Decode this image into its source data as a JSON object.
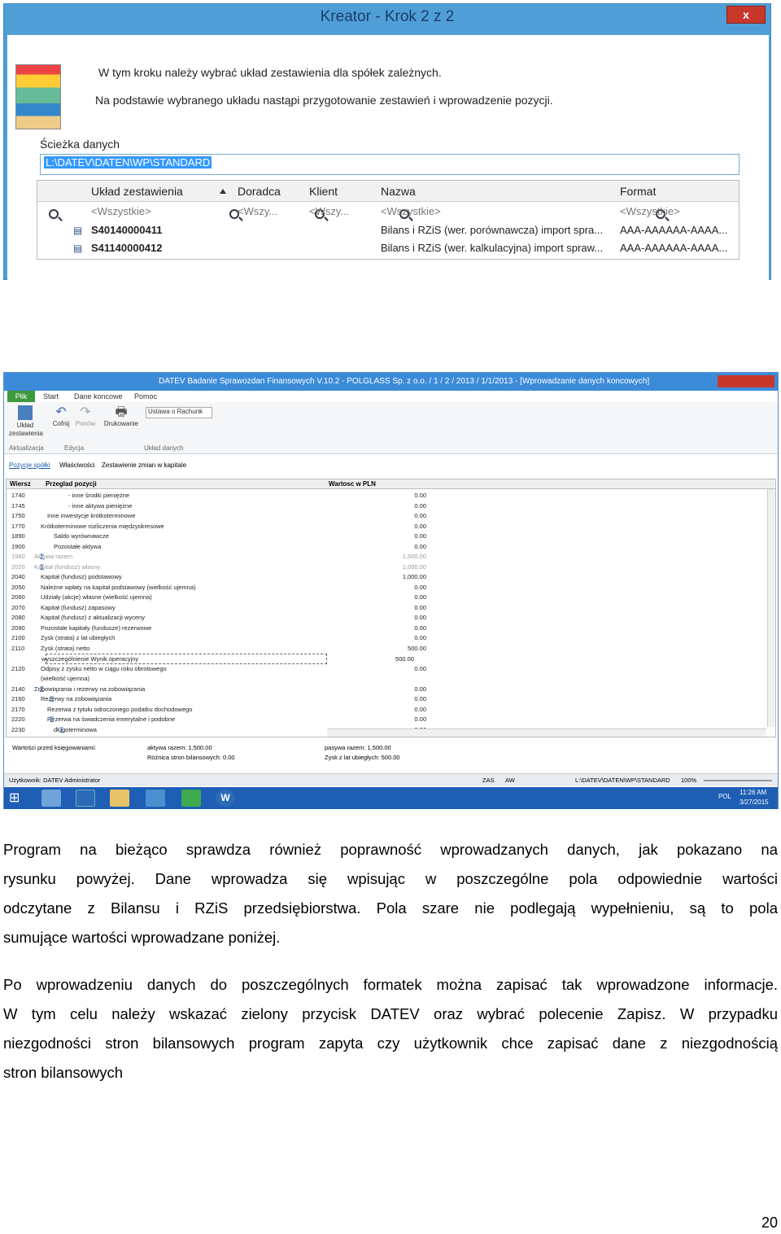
{
  "wizard": {
    "title": "Kreator - Krok 2 z 2",
    "close": "x",
    "line1": "W tym kroku należy wybrać układ zestawienia dla spółek zależnych.",
    "line2": "Na podstawie wybranego układu nastąpi przygotowanie zestawień i wprowadzenie pozycji.",
    "path_label": "Ścieżka danych",
    "path_value": "L:\\DATEV\\DATEN\\WP\\STANDARD",
    "columns": [
      "Układ zestawienia",
      "Doradca",
      "Klient",
      "Nazwa",
      "Format"
    ],
    "filters": [
      "<Wszystkie>",
      "<Wszy...",
      "<Wszy...",
      "<Wszystkie>",
      "<Wszystkie>"
    ],
    "rows": [
      {
        "uklad": "S40140000411",
        "nazwa": "Bilans i RZiS (wer. porównawcza) import spra...",
        "format": "AAA-AAAAAA-AAAA..."
      },
      {
        "uklad": "S41140000412",
        "nazwa": "Bilans i RZiS (wer. kalkulacyjna) import spraw...",
        "format": "AAA-AAAAAA-AAAA..."
      }
    ]
  },
  "app": {
    "title": "DATEV Badanie Sprawozdan Finansowych V.10.2 - POLGLASS Sp. z o.o. / 1 / 2 / 2013 / 1/1/2013 - [Wprowadzanie danych koncowych]",
    "tabs": [
      "Plik",
      "Start",
      "Dane koncowe",
      "Pomoc"
    ],
    "ribbon": {
      "btn_uklad": "Układ zestawienia",
      "btn_cofnij": "Cofnij",
      "btn_ponow": "Ponów",
      "btn_drukowanie": "Drukowanie",
      "dropdown": "Ustawa o Rachunk",
      "grp_aktualizacja": "Aktualizacja",
      "grp_edycja": "Edycja",
      "grp_uklad": "Układ danych"
    },
    "subtabs": [
      "Pozycje spółki",
      "Właściwości",
      "Zestawienie zmian w kapitale"
    ],
    "table_headers": [
      "Wiersz",
      "Przeglad pozycji",
      "Wartosc w PLN"
    ],
    "rows": [
      {
        "n": "1740",
        "d": "- inne środki pieniężne",
        "v": "0.00"
      },
      {
        "n": "1745",
        "d": "- inne aktywa pieniężne",
        "v": "0.00"
      },
      {
        "n": "1750",
        "d": "Inne inwestycje krótkoterminowe",
        "v": "0.00"
      },
      {
        "n": "1770",
        "d": "Krótkoterminowe rozliczenia międzyokresowe",
        "v": "0.00"
      },
      {
        "n": "1890",
        "d": "Saldo wyrównawcze",
        "v": "0.00"
      },
      {
        "n": "1900",
        "d": "Pozostałe aktywa",
        "v": "0.00"
      },
      {
        "n": "1980",
        "d": "Aktywa razem",
        "v": "1,500.00"
      },
      {
        "n": "2020",
        "d": "Kapitał (fundusz) własny",
        "v": "1,000.00"
      },
      {
        "n": "2040",
        "d": "Kapitał (fundusz) podstawowy",
        "v": "1,000.00"
      },
      {
        "n": "2050",
        "d": "Należne wpłaty na kapitał podstawowy (wielkość ujemna)",
        "v": "0.00"
      },
      {
        "n": "2060",
        "d": "Udziały (akcje) własne (wielkość ujemna)",
        "v": "0.00"
      },
      {
        "n": "2070",
        "d": "Kapitał (fundusz) zapasowy",
        "v": "0.00"
      },
      {
        "n": "2080",
        "d": "Kapitał (fundusz) z aktualizacji wyceny",
        "v": "0.00"
      },
      {
        "n": "2090",
        "d": "Pozostałe kapitały (fundusze) rezerwowe",
        "v": "0.00"
      },
      {
        "n": "2100",
        "d": "Zysk (strata) z lat ubiegłych",
        "v": "0.00"
      },
      {
        "n": "2110",
        "d": "Zysk (strata) netto",
        "v": "500.00"
      },
      {
        "n": "",
        "d": "wyszczególnienie Wynik operacyjny",
        "v": "500.00"
      },
      {
        "n": "2120",
        "d": "Odpisy z zysku netto w ciągu roku obrotowego",
        "v": "0.00"
      },
      {
        "n": "",
        "d": "(wielkość ujemna)",
        "v": ""
      },
      {
        "n": "2140",
        "d": "Zobowiązania i rezerwy na zobowiązania",
        "v": "0.00"
      },
      {
        "n": "2160",
        "d": "Rezerwy na zobowiązania",
        "v": "0.00"
      },
      {
        "n": "2170",
        "d": "Rezerwa z tytułu odroczonego podatku dochodowego",
        "v": "0.00"
      },
      {
        "n": "2220",
        "d": "Rezerwa na świadczenia emerytalne i podobne",
        "v": "0.00"
      },
      {
        "n": "2230",
        "d": "długoterminowa",
        "v": "0.00"
      }
    ],
    "summary": {
      "label": "Wartości przed księgowaniami:",
      "aktywa": "aktywa razem: 1,500.00",
      "roznica": "Różnica stron bilansowych: 0.00",
      "pasywa": "pasywa razem: 1,500.00",
      "zysk": "Zysk z lat ubiegłych: 500.00"
    },
    "status": {
      "user": "Użytkownik: DATEV Administrator",
      "zas": "ZAS",
      "aw": "AW",
      "path": "L:\\DATEV\\DATEN\\WP\\STANDARD",
      "zoom": "100%"
    },
    "taskbar": {
      "lang": "POL",
      "time": "11:26 AM",
      "date": "3/27/2015"
    }
  },
  "text": {
    "p1_l1": "Program na bieżąco sprawdza również poprawność wprowadzanych danych, jak pokazano na",
    "p1_l2": "rysunku powyżej. Dane wprowadza się wpisując w poszczególne pola odpowiednie wartości",
    "p1_l3": "odczytane z Bilansu i RZiS przedsiębiorstwa. Pola szare nie podlegają wypełnieniu, są to pola",
    "p1_l4": "sumujące wartości wprowadzane poniżej.",
    "p2_l1": "Po wprowadzeniu danych do poszczególnych formatek można zapisać tak wprowadzone informacje.",
    "p2_l2": "W tym celu należy wskazać zielony przycisk DATEV oraz wybrać polecenie Zapisz. W przypadku",
    "p2_l3": "niezgodności stron bilansowych program zapyta czy użytkownik chce zapisać dane z niezgodnością",
    "p2_l4": "stron bilansowych"
  },
  "page_number": "20"
}
